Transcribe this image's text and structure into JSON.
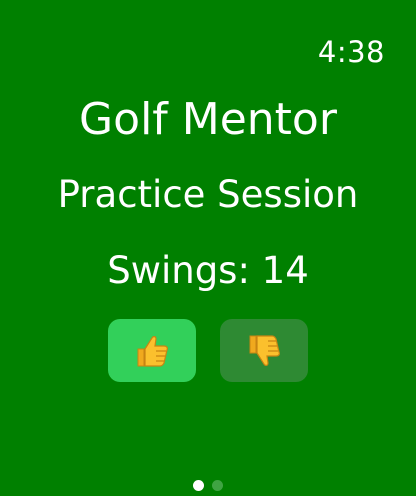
{
  "status": {
    "time": "4:38"
  },
  "app": {
    "title": "Golf Mentor"
  },
  "session": {
    "name": "Practice Session",
    "swings_text": "Swings: 14",
    "swings": 14
  },
  "buttons": {
    "thumbs_up": {
      "icon": "thumbs-up-icon",
      "color": "#32d05a"
    },
    "thumbs_down": {
      "icon": "thumbs-down-icon",
      "color": "#2e8a33"
    }
  },
  "pager": {
    "page_count": 2,
    "current_page": 1
  },
  "colors": {
    "background": "#008000",
    "text": "#ffffff",
    "emoji_yellow": "#fbc02d"
  }
}
